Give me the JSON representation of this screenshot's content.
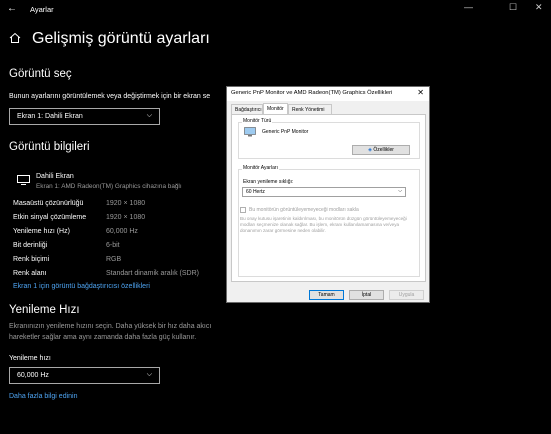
{
  "window": {
    "app_title": "Ayarlar",
    "back": "←",
    "min": "—",
    "max": "☐",
    "close": "✕"
  },
  "page": {
    "title": "Gelişmiş görüntü ayarları"
  },
  "select_display": {
    "heading": "Görüntü seç",
    "description": "Bunun ayarlarını görüntülemek veya değiştirmek için bir ekran se",
    "dropdown_value": "Ekran 1: Dahili Ekran"
  },
  "display_info": {
    "heading": "Görüntü bilgileri",
    "monitor_name": "Dahili Ekran",
    "monitor_sub": "Ekran 1: AMD Radeon(TM) Graphics cihazına bağlı",
    "rows": [
      {
        "label": "Masaüstü çözünürlüğü",
        "value": "1920 × 1080"
      },
      {
        "label": "Etkin sinyal çözümleme",
        "value": "1920 × 1080"
      },
      {
        "label": "Yenileme hızı (Hz)",
        "value": "60,000 Hz"
      },
      {
        "label": "Bit derinliği",
        "value": "6-bit"
      },
      {
        "label": "Renk biçimi",
        "value": "RGB"
      },
      {
        "label": "Renk alanı",
        "value": "Standart dinamik aralık (SDR)"
      }
    ],
    "adapter_link": "Ekran 1 için görüntü bağdaştırıcısı özellikleri"
  },
  "refresh": {
    "heading": "Yenileme Hızı",
    "description_line1": "Ekranınızın yenileme hızını seçin. Daha yüksek bir hız daha akıcı",
    "description_line2": "hareketler sağlar ama aynı zamanda daha fazla güç kullanır.",
    "field_label": "Yenileme hızı",
    "dropdown_value": "60,000 Hz",
    "more_link": "Daha fazla bilgi edinin"
  },
  "dialog": {
    "title": "Generic PnP Monitor ve AMD Radeon(TM) Graphics Özellikleri",
    "close": "✕",
    "tabs": [
      "Bağdaştırıcı",
      "Monitör",
      "Renk Yönetimi"
    ],
    "active_tab": "Monitör",
    "monitor_type_group": "Monitör Türü",
    "monitor_type_name": "Generic PnP Monitor",
    "properties_button": "Özellikler",
    "monitor_settings_group": "Monitör Ayarları",
    "refresh_label": "Ekran yenileme sıklığı:",
    "refresh_value": "60 Hertz",
    "hide_modes_label": "Bu monitörün görüntüleyemeyeceği modları sakla",
    "hide_modes_desc": "Bu onay kutusu işaretinin kaldırılması, bu monitörün düzgün görüntüleyemeyeceği modları seçmenize olanak sağlar. Bu işlem, ekranı kullanılamamasına ve/veya donanımın zarar görmesine neden olabilir.",
    "ok": "Tamam",
    "cancel": "İptal",
    "apply": "Uygula"
  },
  "colors": {
    "background": "#000000",
    "link": "#4ea4f2",
    "accent": "#0078d7"
  }
}
